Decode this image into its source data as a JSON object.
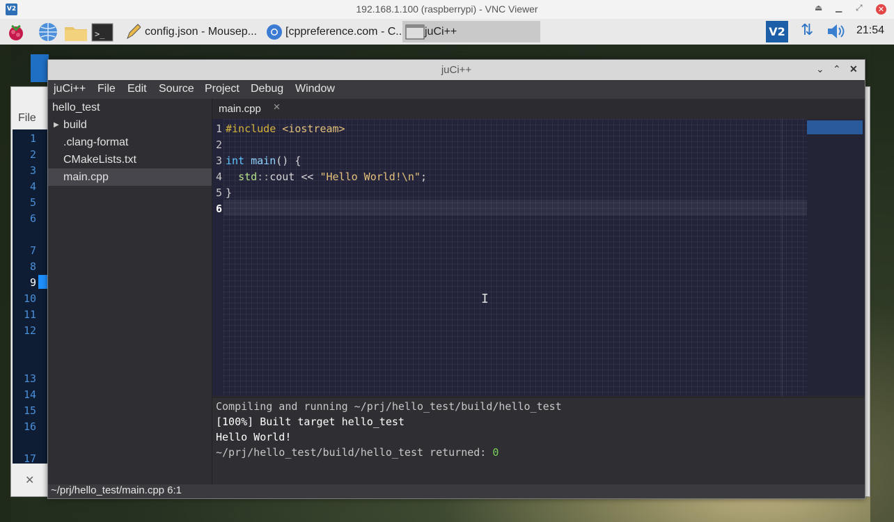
{
  "vnc": {
    "title": "192.168.1.100 (raspberrypi) - VNC Viewer",
    "logo": "V2"
  },
  "taskbar": {
    "tasks": [
      {
        "label": "config.json - Mousep...",
        "icon": "text-editor-icon"
      },
      {
        "label": "[cppreference.com - C...",
        "icon": "chromium-icon"
      },
      {
        "label": "juCi++",
        "icon": "window-icon"
      }
    ],
    "clock": "21:54",
    "tray_vnc": "V2"
  },
  "background_window": {
    "menu_file": "File",
    "line_numbers": [
      "1",
      "2",
      "3",
      "4",
      "5",
      "6",
      "7",
      "8",
      "9",
      "10",
      "11",
      "12",
      "13",
      "14",
      "15",
      "16",
      "17"
    ],
    "close_glyph": "✕"
  },
  "window": {
    "title": "juCi++",
    "menu": [
      "juCi++",
      "File",
      "Edit",
      "Source",
      "Project",
      "Debug",
      "Window"
    ]
  },
  "sidebar": {
    "project": "hello_test",
    "items": [
      {
        "label": "build",
        "expander": "▶"
      },
      {
        "label": ".clang-format"
      },
      {
        "label": "CMakeLists.txt"
      },
      {
        "label": "main.cpp"
      }
    ]
  },
  "tab": {
    "label": "main.cpp",
    "close": "✕"
  },
  "editor": {
    "line_numbers": [
      "1",
      "2",
      "3",
      "4",
      "5",
      "6"
    ],
    "current_line": 6,
    "lines": {
      "l1_directive": "#include",
      "l1_header": "<iostream>",
      "l3_type": "int",
      "l3_name": "main",
      "l3_rest": "() {",
      "l4_ns": "std",
      "l4_sep": "::",
      "l4_ident": "cout",
      "l4_op": " << ",
      "l4_str": "\"Hello World!\\n\"",
      "l4_end": ";",
      "l5_brace": "}"
    }
  },
  "terminal": {
    "lines": [
      "Compiling and running ~/prj/hello_test/build/hello_test",
      "[100%] Built target hello_test",
      "Hello World!"
    ],
    "return_prefix": "~/prj/hello_test/build/hello_test returned: ",
    "return_code": "0"
  },
  "status": {
    "text": "~/prj/hello_test/main.cpp 6:1"
  },
  "colors": {
    "accent": "#3d7cd1",
    "keyword": "#5ec4ff",
    "string": "#e4c07a",
    "directive": "#d6b33b",
    "success": "#7ad05a"
  }
}
